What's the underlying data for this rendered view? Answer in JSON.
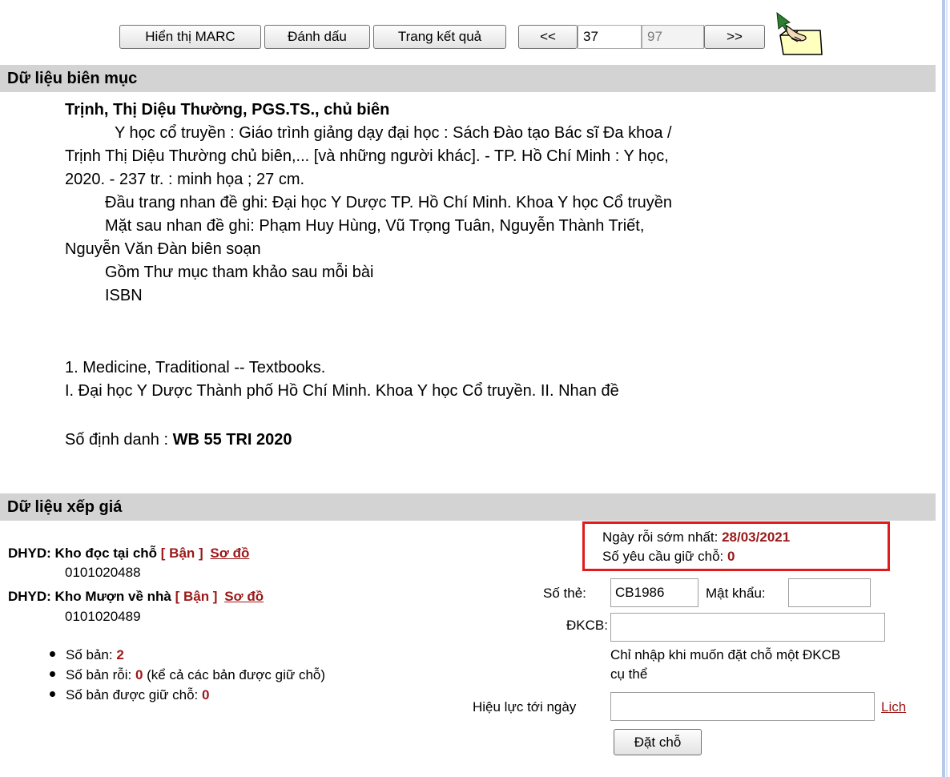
{
  "toolbar": {
    "marc_label": "Hiển thị MARC",
    "mark_label": "Đánh dấu",
    "results_label": "Trang kết quả",
    "prev_label": "<<",
    "current_record": "37",
    "total_records": "97",
    "next_label": ">>",
    "hand_icon": "pointing-hand-folder-icon"
  },
  "catalog": {
    "section_title": "Dữ liệu biên mục",
    "author": "Trịnh, Thị Diệu Thường, PGS.TS., chủ biên",
    "title_line1": "Y học cổ truyền : Giáo trình giảng dạy đại học : Sách Đào tạo Bác sĩ Đa khoa /",
    "title_line2": "Trịnh Thị Diệu Thường chủ biên,... [và những người khác]. - TP. Hồ Chí Minh : Y học,",
    "title_line3": "2020. - 237 tr. : minh họa ; 27 cm.",
    "note1": "Đầu trang nhan đề ghi: Đại học Y Dược TP. Hồ Chí Minh. Khoa Y học Cổ truyền",
    "note2_line1": "Mặt sau nhan đề ghi: Phạm Huy Hùng, Vũ Trọng Tuân, Nguyễn Thành Triết,",
    "note2_line2": "Nguyễn Văn Đàn biên soạn",
    "note3": "Gồm Thư mục tham khảo sau mỗi bài",
    "note4": "ISBN",
    "subject1": "1. Medicine, Traditional -- Textbooks.",
    "subject2": "I. Đại học Y Dược Thành phố Hồ Chí Minh. Khoa Y học Cổ truyền. II. Nhan đề",
    "call_label": "Số định danh : ",
    "call_number": "WB 55 TRI 2020"
  },
  "holdings": {
    "section_title": "Dữ liệu xếp giá",
    "locations": [
      {
        "name": "DHYD: Kho đọc tại chỗ",
        "status": "[ Bận ]",
        "map_link": "Sơ đồ",
        "barcode": "0101020488"
      },
      {
        "name": "DHYD: Kho Mượn về nhà",
        "status": "[ Bận ]",
        "map_link": "Sơ đồ",
        "barcode": "0101020489"
      }
    ],
    "copies_label": "Số bản: ",
    "copies_value": "2",
    "free_label": "Số bản rỗi: ",
    "free_value": "0",
    "free_note": " (kể cả các bản được giữ chỗ)",
    "held_label": "Số bản được giữ chỗ: ",
    "held_value": "0"
  },
  "reservation": {
    "earliest_label": "Ngày rỗi sớm nhất: ",
    "earliest_date": "28/03/2021",
    "requests_label": "Số yêu cầu giữ chỗ: ",
    "requests_value": "0",
    "card_label": "Số thẻ:",
    "card_value": "CB1986",
    "password_label": "Mật khẩu:",
    "password_value": "",
    "barcode_label": "ĐKCB:",
    "barcode_value": "",
    "barcode_hint_line1": "Chỉ nhập khi muốn đặt chỗ một ĐKCB",
    "barcode_hint_line2": "cụ thể",
    "valid_label": "Hiệu lực tới ngày",
    "valid_value": "",
    "calendar_link": "Lich",
    "submit_label": "Đặt chỗ"
  },
  "colors": {
    "section_bar": "#d3d3d3",
    "accent_red": "#9b1818",
    "highlight_box": "#e01b1b"
  }
}
